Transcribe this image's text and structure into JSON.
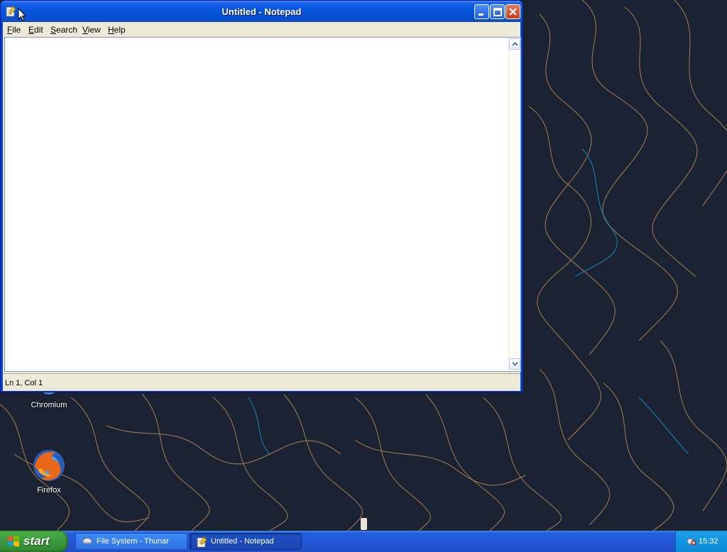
{
  "window": {
    "title": "Untitled - Notepad",
    "menu": [
      "File",
      "Edit",
      "Search",
      "View",
      "Help"
    ],
    "menu_mnemonics": [
      "F",
      "E",
      "S",
      "V",
      "H"
    ],
    "editor_text": "",
    "status": "Ln 1, Col 1"
  },
  "desktop": {
    "icons": [
      {
        "label": "Chromium",
        "icon": "chromium-icon"
      },
      {
        "label": "Firefox",
        "icon": "firefox-icon"
      }
    ]
  },
  "taskbar": {
    "start_label": "start",
    "tasks": [
      {
        "label": "File System - Thunar",
        "icon": "thunar-icon",
        "active": false
      },
      {
        "label": "Untitled - Notepad",
        "icon": "notepad-icon",
        "active": true
      }
    ],
    "clock": "15:32"
  },
  "colors": {
    "title_bar": "#0756e0",
    "taskbar": "#245edb",
    "start_button": "#3c9c3c",
    "tray": "#0d8ad7",
    "wallpaper": "#1b2332",
    "wallpaper_lines": "#c89a5a"
  }
}
